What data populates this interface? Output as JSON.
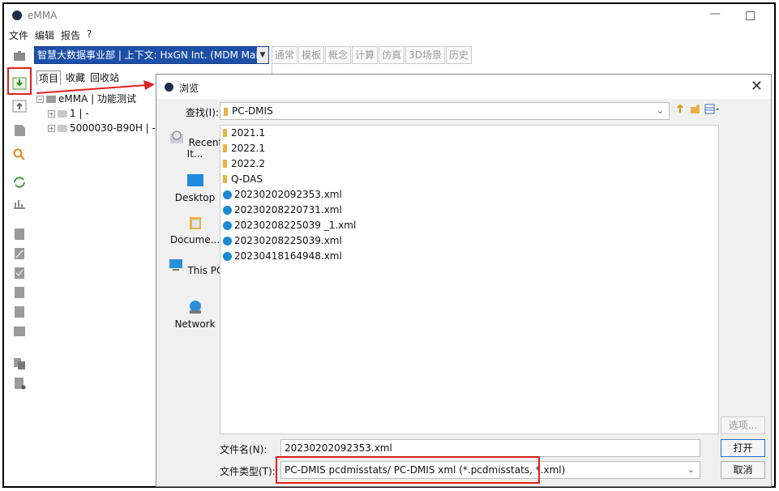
{
  "app": {
    "title": "eMMA"
  },
  "menu": [
    "文件",
    "编辑",
    "报告",
    "?"
  ],
  "context_selector": {
    "value": "智慧大数据事业部 | 上下文: HxGN Int. (MDM Main..."
  },
  "top_tabs": [
    "通常",
    "模板",
    "概念",
    "计算",
    "仿真",
    "3D场景",
    "历史"
  ],
  "project_tabs": [
    "项目",
    "收藏",
    "回收站"
  ],
  "tree": {
    "root": "eMMA | 功能测试",
    "children": [
      "1 | -",
      "5000030-B90H | -"
    ]
  },
  "dialog": {
    "title": "浏览",
    "look_in_label": "查找(I):",
    "look_in_value": "PC-DMIS",
    "places": [
      "Recent It...",
      "Desktop",
      "Docume...",
      "This PC",
      "Network"
    ],
    "files": [
      {
        "name": "2021.1",
        "type": "folder"
      },
      {
        "name": "2022.1",
        "type": "folder"
      },
      {
        "name": "2022.2",
        "type": "folder"
      },
      {
        "name": "Q-DAS",
        "type": "folder"
      },
      {
        "name": "20230202092353.xml",
        "type": "xml"
      },
      {
        "name": "20230208220731.xml",
        "type": "xml"
      },
      {
        "name": "20230208225039 _1.xml",
        "type": "xml"
      },
      {
        "name": "20230208225039.xml",
        "type": "xml"
      },
      {
        "name": "20230418164948.xml",
        "type": "xml"
      }
    ],
    "options_label": "选项...",
    "file_name_label": "文件名(N):",
    "file_name_value": "20230202092353.xml",
    "file_type_label": "文件类型(T):",
    "file_type_value": "PC-DMIS pcdmisstats/ PC-DMIS xml (*.pcdmisstats, *.xml)",
    "open_label": "打开",
    "cancel_label": "取消"
  },
  "colors": {
    "accent_blue": "#1e4fa8",
    "highlight_red": "#e02020",
    "folder_yellow": "#e8b341",
    "xml_icon_blue": "#1a8ad4"
  }
}
